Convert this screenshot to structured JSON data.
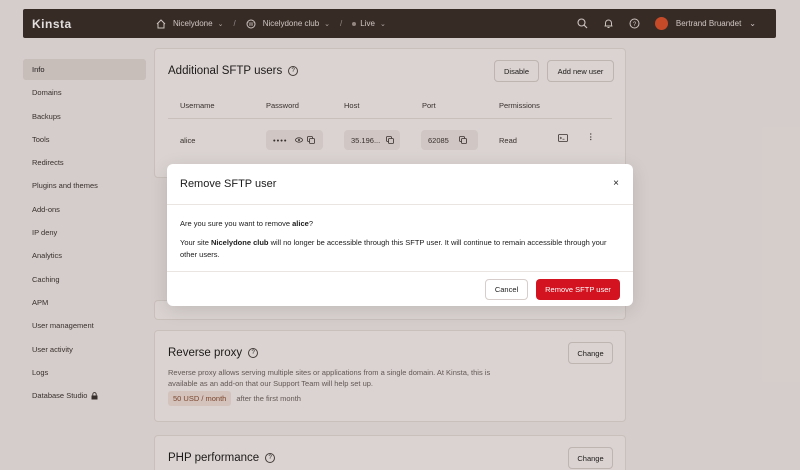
{
  "app": {
    "logo": "Kinsta"
  },
  "breadcrumb": {
    "company": "Nicelydone",
    "site": "Nicelydone club",
    "environment": "Live"
  },
  "user": {
    "name": "Bertrand Bruandet"
  },
  "sidebar": {
    "items": [
      {
        "label": "Info",
        "active": true
      },
      {
        "label": "Domains"
      },
      {
        "label": "Backups"
      },
      {
        "label": "Tools"
      },
      {
        "label": "Redirects"
      },
      {
        "label": "Plugins and themes"
      },
      {
        "label": "Add-ons"
      },
      {
        "label": "IP deny"
      },
      {
        "label": "Analytics"
      },
      {
        "label": "Caching"
      },
      {
        "label": "APM"
      },
      {
        "label": "User management"
      },
      {
        "label": "User activity"
      },
      {
        "label": "Logs"
      },
      {
        "label": "Database Studio"
      }
    ]
  },
  "sftp": {
    "title": "Additional SFTP users",
    "disable_label": "Disable",
    "add_label": "Add new user",
    "columns": [
      "Username",
      "Password",
      "Host",
      "Port",
      "Permissions"
    ],
    "row": {
      "username": "alice",
      "password": "••••",
      "host": "35.196...",
      "port": "62085",
      "permissions": "Read"
    }
  },
  "reverse_proxy": {
    "title": "Reverse proxy",
    "change_label": "Change",
    "description": "Reverse proxy allows serving multiple sites or applications from a single domain. At Kinsta, this is available as an add-on that our Support Team will help set up.",
    "price": "50 USD / month",
    "price_suffix": "after the first month"
  },
  "php": {
    "title": "PHP performance",
    "change_label": "Change"
  },
  "modal": {
    "title": "Remove SFTP user",
    "close": "×",
    "question_prefix": "Are you sure you want to remove ",
    "question_user": "alice",
    "question_suffix": "?",
    "body_prefix": "Your site ",
    "body_site": "Nicelydone club",
    "body_suffix": " will no longer be accessible through this SFTP user. It will continue to remain accessible through your other users.",
    "cancel_label": "Cancel",
    "remove_label": "Remove SFTP user",
    "remove_color": "#d3131f"
  },
  "icons": {
    "home": "home-icon",
    "wordpress": "wordpress-icon",
    "search": "search-icon",
    "bell": "bell-icon",
    "help": "help-icon",
    "lock": "lock-icon",
    "eye": "eye-icon",
    "copy": "copy-icon",
    "terminal": "terminal-icon",
    "more": "more-vertical-icon"
  }
}
